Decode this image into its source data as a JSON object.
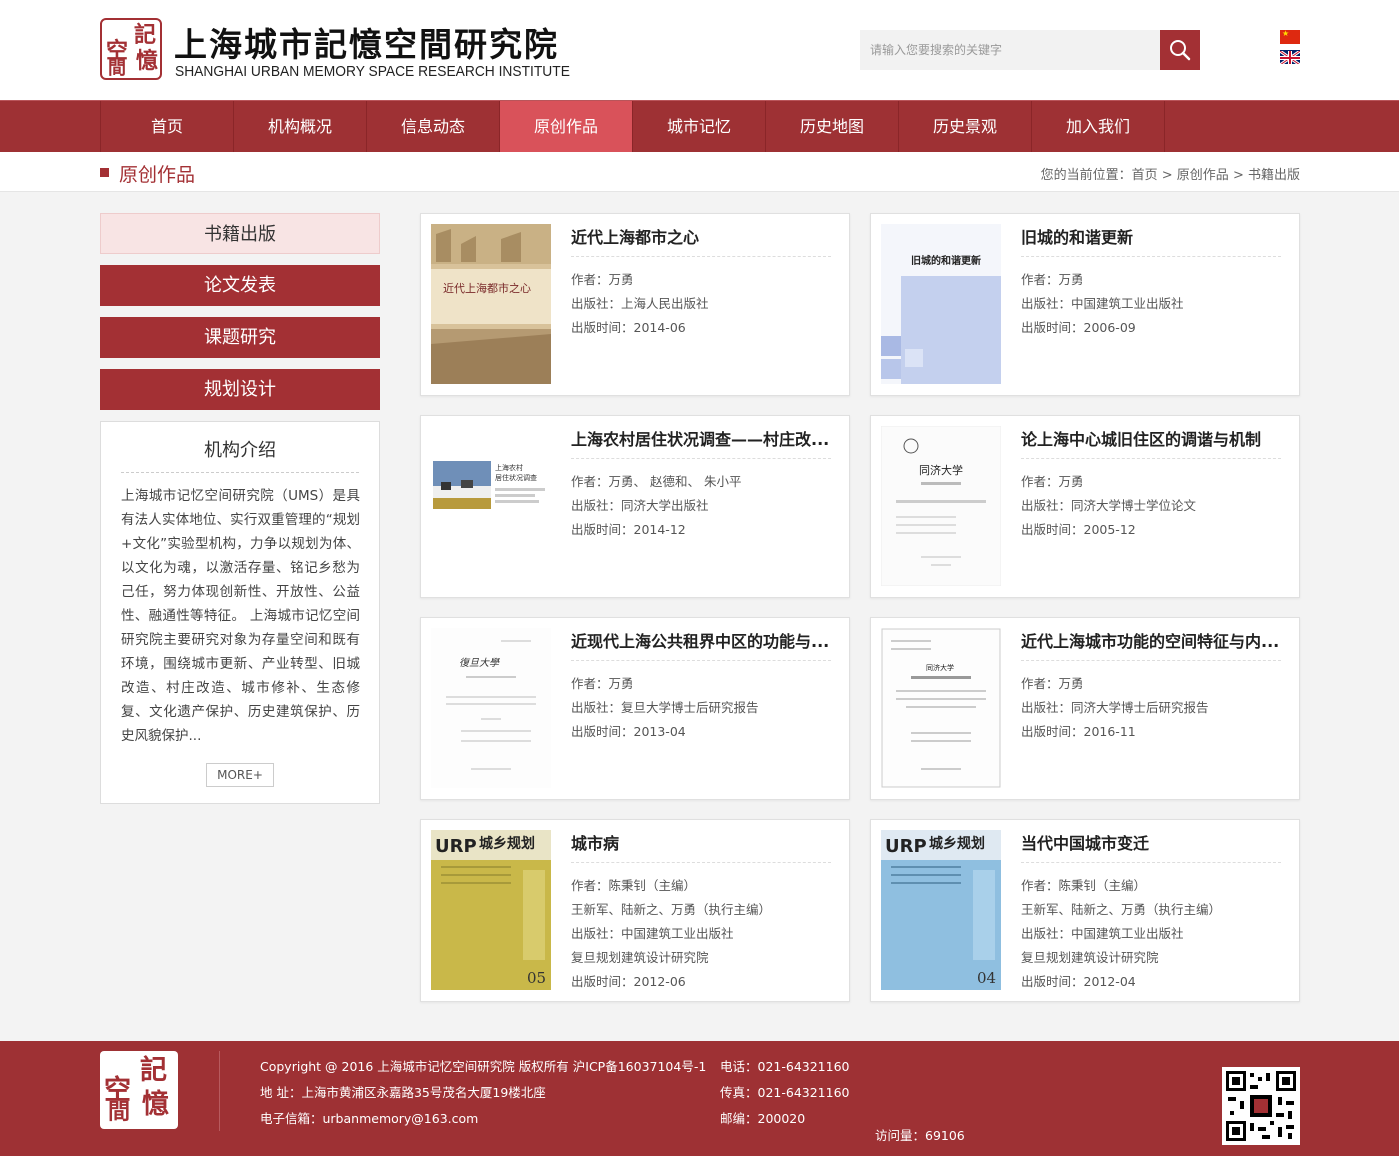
{
  "header": {
    "logo_glyphs": [
      "空",
      "記",
      "間",
      "憶"
    ],
    "title": "上海城市記憶空間研究院",
    "subtitle": "SHANGHAI URBAN MEMORY SPACE RESEARCH INSTITUTE",
    "search_placeholder": "请输入您要搜索的关键字",
    "search_icon": "search-icon",
    "languages": [
      "zh-flag",
      "en-flag"
    ]
  },
  "nav": {
    "items": [
      "首页",
      "机构概况",
      "信息动态",
      "原创作品",
      "城市记忆",
      "历史地图",
      "历史景观",
      "加入我们"
    ],
    "active_index": 3
  },
  "breadcrumb": {
    "section_title": "原创作品",
    "prefix": "您的当前位置：",
    "path": [
      "首页",
      "原创作品",
      "书籍出版"
    ],
    "separator": ">"
  },
  "sidebar": {
    "menu": [
      "书籍出版",
      "论文发表",
      "课题研究",
      "规划设计"
    ],
    "active_index": 0,
    "intro_title": "机构介绍",
    "intro_text": "上海城市记忆空间研究院（UMS）是具有法人实体地位、实行双重管理的“规划+文化”实验型机构，力争以规划为体、以文化为魂，以激活存量、铭记乡愁为己任，努力体现创新性、开放性、公益性、融通性等特征。 上海城市记忆空间研究院主要研究对象为存量空间和既有环境，围绕城市更新、产业转型、旧城改造、村庄改造、城市修补、生态修复、文化遗产保护、历史建筑保护、历史风貌保护...",
    "more_label": "MORE+"
  },
  "books": [
    {
      "title": "近代上海都市之心",
      "meta": [
        "作者：万勇",
        "出版社：上海人民出版社",
        "出版时间：2014-06"
      ],
      "cover_text": "近代上海都市之心"
    },
    {
      "title": "旧城的和谐更新",
      "meta": [
        "作者：万勇",
        "出版社：中国建筑工业出版社",
        "出版时间：2006-09"
      ],
      "cover_text": "旧城的和谐更新"
    },
    {
      "title": "上海农村居住状况调查——村庄改...",
      "meta": [
        "作者：万勇、 赵德和、 朱小平",
        "出版社：同济大学出版社",
        "出版时间：2014-12"
      ],
      "cover_text": "上海农村居住状况调查"
    },
    {
      "title": "论上海中心城旧住区的调谐与机制",
      "meta": [
        "作者：万勇",
        "出版社：同济大学博士学位论文",
        "出版时间：2005-12"
      ],
      "cover_text": "同济大学"
    },
    {
      "title": "近现代上海公共租界中区的功能与...",
      "meta": [
        "作者：万勇",
        "出版社：复旦大学博士后研究报告",
        "出版时间：2013-04"
      ],
      "cover_text": "復旦大學"
    },
    {
      "title": "近代上海城市功能的空间特征与内...",
      "meta": [
        "作者：万勇",
        "出版社：同济大学博士后研究报告",
        "出版时间：2016-11"
      ],
      "cover_text": "同济大学"
    },
    {
      "title": "城市病",
      "meta": [
        "作者：陈秉钊（主编）",
        "王新军、陆新之、万勇（执行主编）",
        "出版社：中国建筑工业出版社",
        "复旦规划建筑设计研究院",
        "出版时间：2012-06"
      ],
      "cover_text": "城乡规划",
      "cover_no": "05"
    },
    {
      "title": "当代中国城市变迁",
      "meta": [
        "作者：陈秉钊（主编）",
        "王新军、陆新之、万勇（执行主编）",
        "出版社：中国建筑工业出版社",
        "复旦规划建筑设计研究院",
        "出版时间：2012-04"
      ],
      "cover_text": "城乡规划",
      "cover_no": "04"
    }
  ],
  "footer": {
    "copyright": "Copyright @ 2016 上海城市记忆空间研究院 版权所有 沪ICP备16037104号-1",
    "address": "地 址：上海市黄浦区永嘉路35号茂名大厦19楼北座",
    "email": "电子信箱：urbanmemory@163.com",
    "phone": "电话：021-64321160",
    "fax": "传真：021-64321160",
    "postcode": "邮编：200020",
    "visits": "访问量：69106",
    "qr_icon": "qr-code-icon"
  },
  "colors": {
    "brand": "#9e3134",
    "active_nav": "#d9525a",
    "active_side_bg": "#f8e4e4"
  }
}
